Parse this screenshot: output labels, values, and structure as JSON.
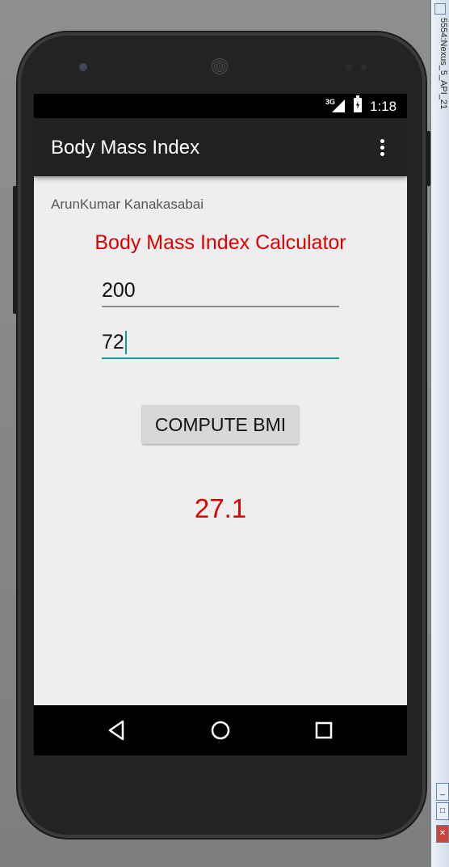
{
  "emulator": {
    "window_title": "5554:Nexus_5_API_21",
    "close_glyph": "✕"
  },
  "status_bar": {
    "network": "3G",
    "time": "1:18"
  },
  "action_bar": {
    "title": "Body Mass Index",
    "overflow_icon": "overflow-menu-icon"
  },
  "content": {
    "author": "ArunKumar Kanakasabai",
    "heading": "Body Mass Index Calculator",
    "heading_color": "#dd0000",
    "weight_value": "200",
    "height_value": "72",
    "compute_label": "COMPUTE BMI",
    "result": "27.1",
    "result_color": "#dd0000"
  },
  "nav_bar": {
    "icons": [
      "back-icon",
      "home-icon",
      "recents-icon"
    ]
  },
  "colors": {
    "accent": "#0f9d8f",
    "action_bar": "#212121",
    "background": "#eeeeee"
  }
}
